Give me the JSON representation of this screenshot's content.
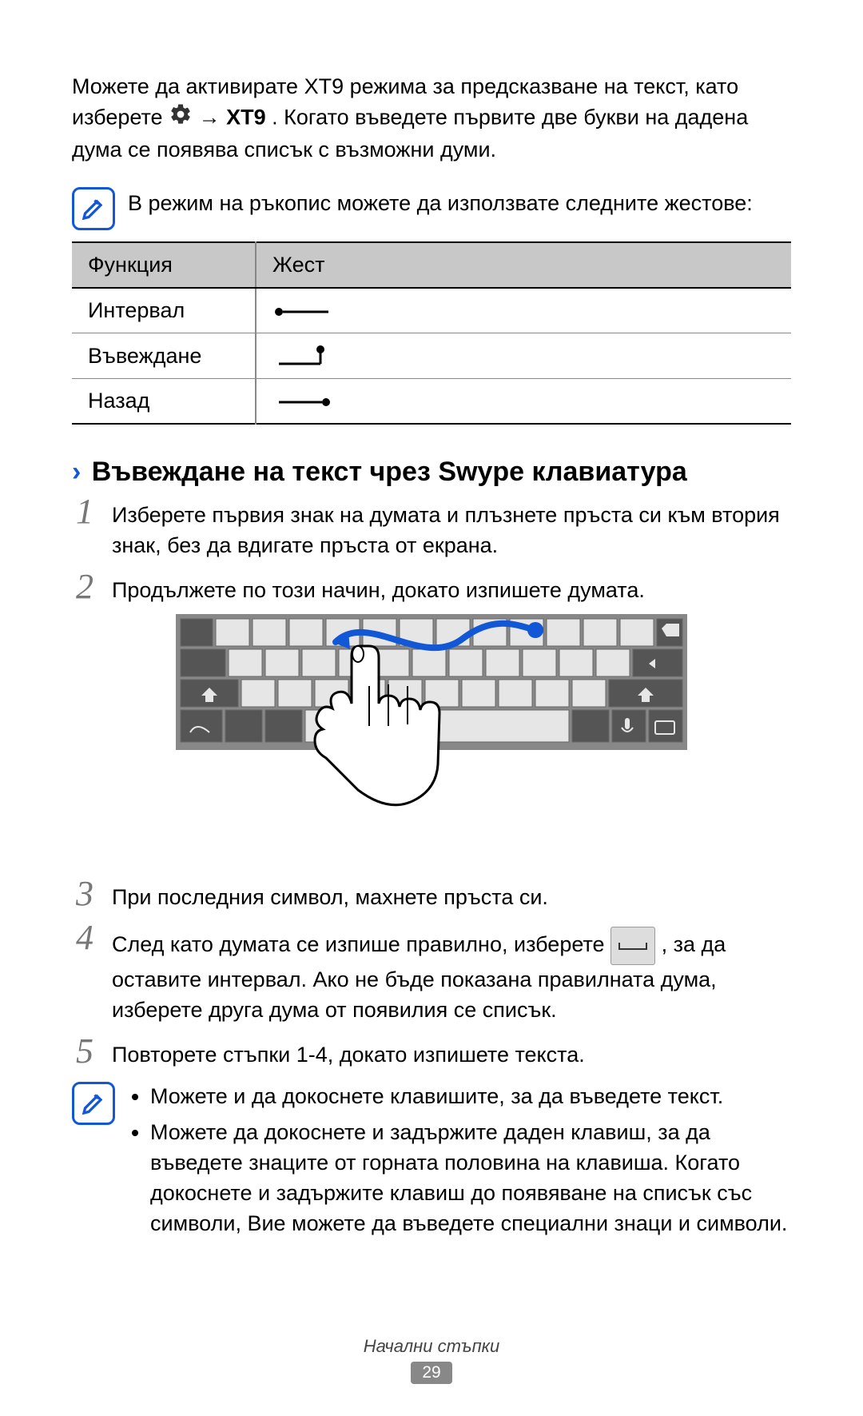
{
  "intro": {
    "p1a": "Можете да активирате XT9 режима за предсказване на текст, като изберете ",
    "arrow": " → ",
    "xt9": "XT9",
    "p1b": ". Когато въведете първите две букви на дадена дума се появява списък с възможни думи."
  },
  "note1": "В режим на ръкопис можете да използвате следните жестове:",
  "table": {
    "head_func": "Функция",
    "head_gest": "Жест",
    "rows": [
      {
        "func": "Интервал"
      },
      {
        "func": "Въвеждане"
      },
      {
        "func": "Назад"
      }
    ]
  },
  "heading": "Въвеждане на текст чрез Swype клавиатура",
  "steps": {
    "s1": "Изберете първия знак на думата и плъзнете пръста си към втория знак, без да вдигате пръста от екрана.",
    "s2": "Продължете по този начин, докато изпишете думата.",
    "s3": "При последния символ, махнете пръста си.",
    "s4a": "След като думата се изпише правилно, изберете ",
    "s4b": ", за да оставите интервал. Ако не бъде показана правилната дума, изберете друга дума от появилия се списък.",
    "s5": "Повторете стъпки 1-4, докато изпишете текста."
  },
  "note2": {
    "b1": "Можете и да докоснете клавишите, за да въведете текст.",
    "b2": "Можете да докоснете и задържите даден клавиш, за да въведете знаците от горната половина на клавиша. Когато докоснете и задържите клавиш до появяване на списък със символи, Вие можете да въведете специални знаци и символи."
  },
  "footer": {
    "section": "Начални стъпки",
    "page": "29"
  }
}
